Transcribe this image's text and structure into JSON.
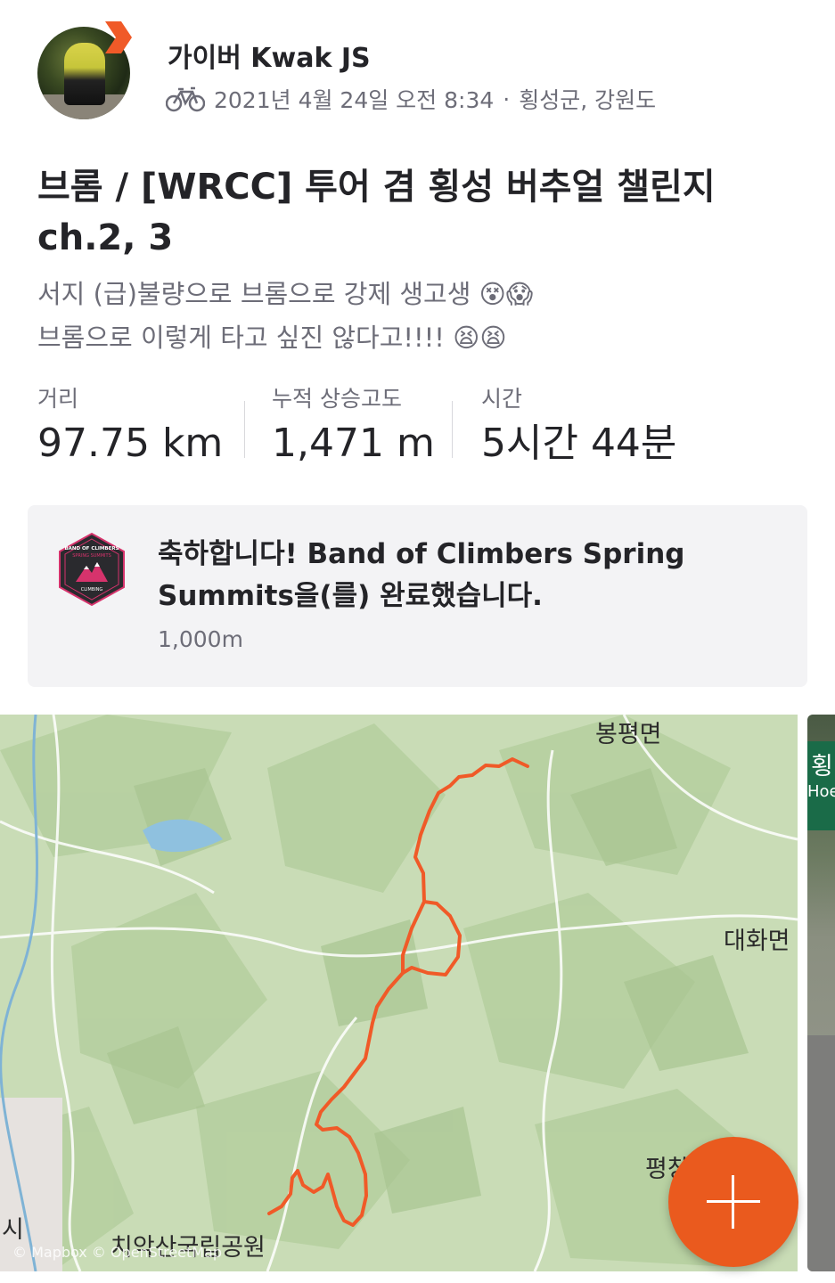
{
  "athlete": {
    "name": "가이버 Kwak JS",
    "activity_type_icon": "bike-icon",
    "datetime": "2021년 4월 24일 오전 8:34",
    "separator": "·",
    "location": "횡성군, 강원도"
  },
  "activity": {
    "title": "브롬 / [WRCC] 투어 겸 횡성 버추얼 챌린지 ch.2, 3",
    "description": "서지 (급)불량으로 브롬으로 강제 생고생 😵😱\n브롬으로 이렇게 타고 싶진 않다고!!!! 😫😫"
  },
  "stats": [
    {
      "label": "거리",
      "value": "97.75 km"
    },
    {
      "label": "누적 상승고도",
      "value": "1,471 m"
    },
    {
      "label": "시간",
      "value": "5시간 44분"
    }
  ],
  "achievement": {
    "title": "축하합니다! Band of Climbers Spring Summits을(를) 완료했습니다.",
    "subtitle": "1,000m",
    "badge_icon": "band-of-climbers-badge-icon",
    "badge_text": [
      "BAND OF CLIMBERS",
      "SPRING SUMMITS",
      "CLIMBING"
    ]
  },
  "map": {
    "places": [
      "봉평면",
      "대화면",
      "평창",
      "시",
      "치악산국립공원"
    ],
    "attribution": "© Mapbox © OpenStreetMap",
    "route_color": "#f05a28"
  },
  "photo": {
    "sign_text_1": "횡",
    "sign_text_2": "Hoe"
  },
  "fab": {
    "icon": "plus-icon",
    "color": "#ea5a1e"
  }
}
